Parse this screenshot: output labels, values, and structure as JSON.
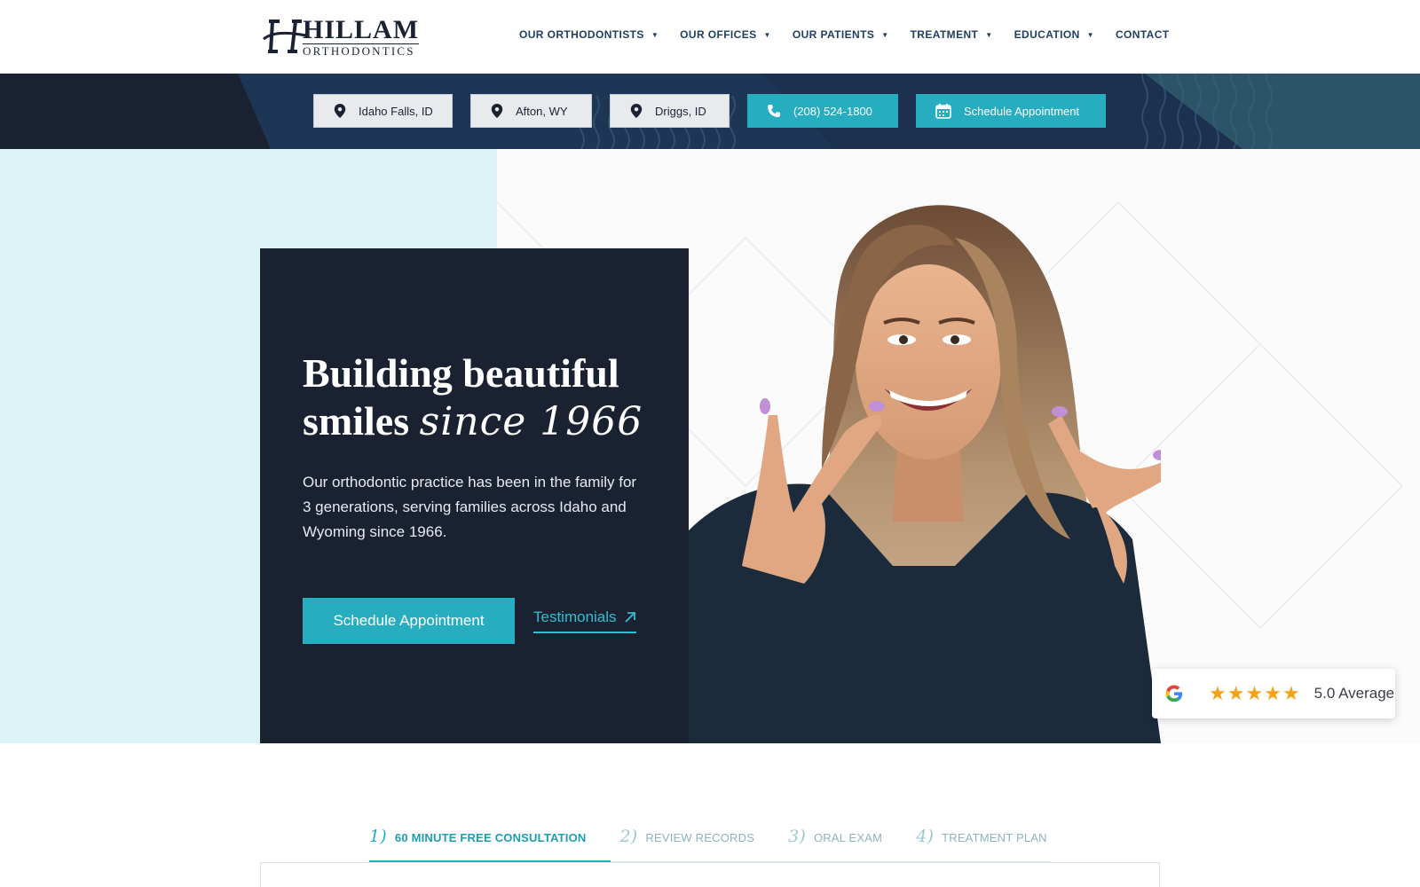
{
  "brand": {
    "name": "HILLAM",
    "subtitle": "ORTHODONTICS",
    "colors": {
      "navy": "#1a2232",
      "teal": "#26adbf",
      "light_teal": "#dcf4f7",
      "star": "#f4a21a"
    }
  },
  "nav": {
    "items": [
      {
        "label": "OUR ORTHODONTISTS",
        "dropdown": true
      },
      {
        "label": "OUR OFFICES",
        "dropdown": true
      },
      {
        "label": "OUR PATIENTS",
        "dropdown": true
      },
      {
        "label": "TREATMENT",
        "dropdown": true
      },
      {
        "label": "EDUCATION",
        "dropdown": true
      },
      {
        "label": "CONTACT",
        "dropdown": false
      }
    ]
  },
  "locations": {
    "offices": [
      {
        "label": "Idaho Falls, ID",
        "icon": "map-pin-icon"
      },
      {
        "label": "Afton, WY",
        "icon": "map-pin-icon"
      },
      {
        "label": "Driggs, ID",
        "icon": "map-pin-icon"
      }
    ],
    "phone": {
      "label": "(208) 524-1800",
      "icon": "phone-icon"
    },
    "schedule": {
      "label": "Schedule Appointment",
      "icon": "calendar-icon"
    }
  },
  "hero": {
    "title_line1": "Building beautiful",
    "title_line2": "smiles",
    "title_script": "since 1966",
    "description": "Our orthodontic practice has been in the family for 3 generations, serving families across Idaho and Wyoming since 1966.",
    "cta_label": "Schedule Appointment",
    "link_label": "Testimonials"
  },
  "review": {
    "provider_icon": "google-icon",
    "stars": 5,
    "average_label": "5.0 Average"
  },
  "steps": {
    "active_index": 0,
    "items": [
      {
        "num": "1)",
        "label": "60 MINUTE FREE CONSULTATION"
      },
      {
        "num": "2)",
        "label": "REVIEW RECORDS"
      },
      {
        "num": "3)",
        "label": "ORAL EXAM"
      },
      {
        "num": "4)",
        "label": "TREATMENT PLAN"
      }
    ]
  }
}
